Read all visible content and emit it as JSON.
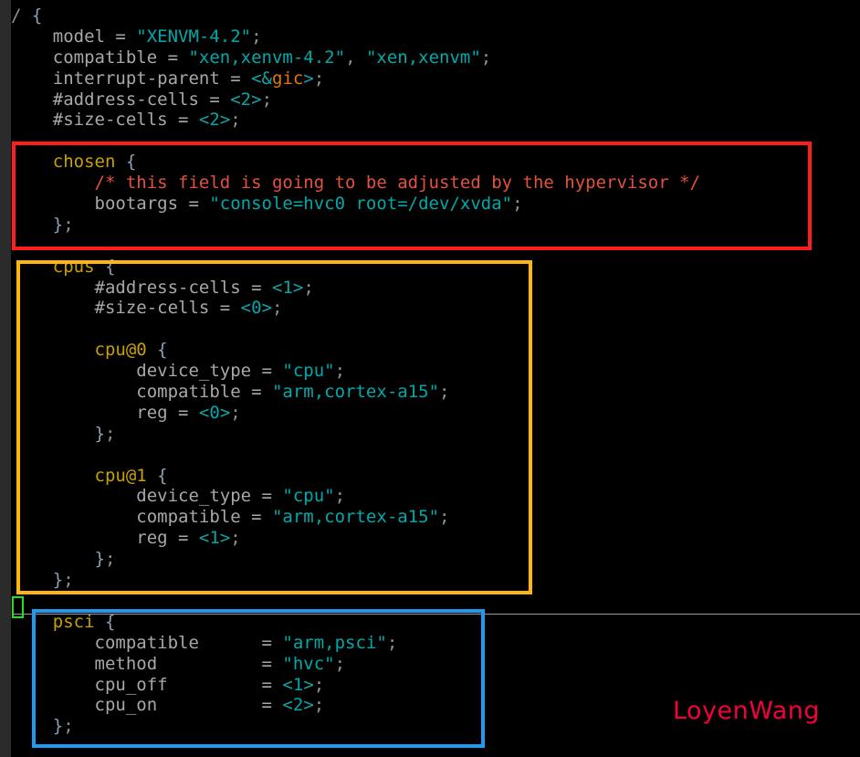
{
  "editor": {
    "language": "Device Tree Source",
    "background_color": "#000000",
    "gutter_color": "#2b2b2b",
    "default_text_color": "#b0b0b0"
  },
  "syntax_colors": {
    "node_name": "#c8a000",
    "property": "#a8a8a8",
    "string": "#00a9a9",
    "number": "#00a9a9",
    "angle_bracket": "#14a3a3",
    "phandle_reference": "#e07b00",
    "comment": "#e2523f",
    "brace": "#8aa0b4"
  },
  "code_lines": [
    {
      "id": "line-1",
      "indent": 0,
      "segments": [
        {
          "t": "punct",
          "v": "/ "
        },
        {
          "t": "brace",
          "v": "{"
        }
      ]
    },
    {
      "id": "line-2",
      "indent": 0,
      "segments": [
        {
          "t": "prop",
          "v": "    model = "
        },
        {
          "t": "str",
          "v": "\"XENVM-4.2\""
        },
        {
          "t": "punct",
          "v": ";"
        }
      ]
    },
    {
      "id": "line-3",
      "indent": 0,
      "segments": [
        {
          "t": "prop",
          "v": "    compatible = "
        },
        {
          "t": "str",
          "v": "\"xen,xenvm-4.2\""
        },
        {
          "t": "punct",
          "v": ", "
        },
        {
          "t": "str",
          "v": "\"xen,xenvm\""
        },
        {
          "t": "punct",
          "v": ";"
        }
      ]
    },
    {
      "id": "line-4",
      "indent": 0,
      "segments": [
        {
          "t": "prop",
          "v": "    interrupt-parent = "
        },
        {
          "t": "angle",
          "v": "<&"
        },
        {
          "t": "ref",
          "v": "gic"
        },
        {
          "t": "angle",
          "v": ">"
        },
        {
          "t": "punct",
          "v": ";"
        }
      ]
    },
    {
      "id": "line-5",
      "indent": 0,
      "segments": [
        {
          "t": "prop",
          "v": "    #address-cells = "
        },
        {
          "t": "angle",
          "v": "<"
        },
        {
          "t": "num",
          "v": "2"
        },
        {
          "t": "angle",
          "v": ">"
        },
        {
          "t": "punct",
          "v": ";"
        }
      ]
    },
    {
      "id": "line-6",
      "indent": 0,
      "segments": [
        {
          "t": "prop",
          "v": "    #size-cells = "
        },
        {
          "t": "angle",
          "v": "<"
        },
        {
          "t": "num",
          "v": "2"
        },
        {
          "t": "angle",
          "v": ">"
        },
        {
          "t": "punct",
          "v": ";"
        }
      ]
    },
    {
      "id": "line-7",
      "indent": 0,
      "segments": [
        {
          "t": "plain",
          "v": ""
        }
      ]
    },
    {
      "id": "line-8",
      "indent": 0,
      "segments": [
        {
          "t": "node",
          "v": "    chosen "
        },
        {
          "t": "brace",
          "v": "{"
        }
      ]
    },
    {
      "id": "line-9",
      "indent": 0,
      "segments": [
        {
          "t": "comment",
          "v": "        /* this field is going to be adjusted by the hypervisor */"
        }
      ]
    },
    {
      "id": "line-10",
      "indent": 0,
      "segments": [
        {
          "t": "prop",
          "v": "        bootargs = "
        },
        {
          "t": "str",
          "v": "\"console=hvc0 root=/dev/xvda\""
        },
        {
          "t": "punct",
          "v": ";"
        }
      ]
    },
    {
      "id": "line-11",
      "indent": 0,
      "segments": [
        {
          "t": "brace",
          "v": "    }"
        },
        {
          "t": "punct",
          "v": ";"
        }
      ]
    },
    {
      "id": "line-12",
      "indent": 0,
      "segments": [
        {
          "t": "plain",
          "v": ""
        }
      ]
    },
    {
      "id": "line-13",
      "indent": 0,
      "segments": [
        {
          "t": "node",
          "v": "    cpus "
        },
        {
          "t": "brace",
          "v": "{"
        }
      ]
    },
    {
      "id": "line-14",
      "indent": 0,
      "segments": [
        {
          "t": "prop",
          "v": "        #address-cells = "
        },
        {
          "t": "angle",
          "v": "<"
        },
        {
          "t": "num",
          "v": "1"
        },
        {
          "t": "angle",
          "v": ">"
        },
        {
          "t": "punct",
          "v": ";"
        }
      ]
    },
    {
      "id": "line-15",
      "indent": 0,
      "segments": [
        {
          "t": "prop",
          "v": "        #size-cells = "
        },
        {
          "t": "angle",
          "v": "<"
        },
        {
          "t": "num",
          "v": "0"
        },
        {
          "t": "angle",
          "v": ">"
        },
        {
          "t": "punct",
          "v": ";"
        }
      ]
    },
    {
      "id": "line-16",
      "indent": 0,
      "segments": [
        {
          "t": "plain",
          "v": ""
        }
      ]
    },
    {
      "id": "line-17",
      "indent": 0,
      "segments": [
        {
          "t": "node",
          "v": "        cpu@0 "
        },
        {
          "t": "brace",
          "v": "{"
        }
      ]
    },
    {
      "id": "line-18",
      "indent": 0,
      "segments": [
        {
          "t": "prop",
          "v": "            device_type = "
        },
        {
          "t": "str",
          "v": "\"cpu\""
        },
        {
          "t": "punct",
          "v": ";"
        }
      ]
    },
    {
      "id": "line-19",
      "indent": 0,
      "segments": [
        {
          "t": "prop",
          "v": "            compatible = "
        },
        {
          "t": "str",
          "v": "\"arm,cortex-a15\""
        },
        {
          "t": "punct",
          "v": ";"
        }
      ]
    },
    {
      "id": "line-20",
      "indent": 0,
      "segments": [
        {
          "t": "prop",
          "v": "            reg = "
        },
        {
          "t": "angle",
          "v": "<"
        },
        {
          "t": "num",
          "v": "0"
        },
        {
          "t": "angle",
          "v": ">"
        },
        {
          "t": "punct",
          "v": ";"
        }
      ]
    },
    {
      "id": "line-21",
      "indent": 0,
      "segments": [
        {
          "t": "brace",
          "v": "        }"
        },
        {
          "t": "punct",
          "v": ";"
        }
      ]
    },
    {
      "id": "line-22",
      "indent": 0,
      "segments": [
        {
          "t": "plain",
          "v": ""
        }
      ]
    },
    {
      "id": "line-23",
      "indent": 0,
      "segments": [
        {
          "t": "node",
          "v": "        cpu@1 "
        },
        {
          "t": "brace",
          "v": "{"
        }
      ]
    },
    {
      "id": "line-24",
      "indent": 0,
      "segments": [
        {
          "t": "prop",
          "v": "            device_type = "
        },
        {
          "t": "str",
          "v": "\"cpu\""
        },
        {
          "t": "punct",
          "v": ";"
        }
      ]
    },
    {
      "id": "line-25",
      "indent": 0,
      "segments": [
        {
          "t": "prop",
          "v": "            compatible = "
        },
        {
          "t": "str",
          "v": "\"arm,cortex-a15\""
        },
        {
          "t": "punct",
          "v": ";"
        }
      ]
    },
    {
      "id": "line-26",
      "indent": 0,
      "segments": [
        {
          "t": "prop",
          "v": "            reg = "
        },
        {
          "t": "angle",
          "v": "<"
        },
        {
          "t": "num",
          "v": "1"
        },
        {
          "t": "angle",
          "v": ">"
        },
        {
          "t": "punct",
          "v": ";"
        }
      ]
    },
    {
      "id": "line-27",
      "indent": 0,
      "segments": [
        {
          "t": "brace",
          "v": "        }"
        },
        {
          "t": "punct",
          "v": ";"
        }
      ]
    },
    {
      "id": "line-28",
      "indent": 0,
      "segments": [
        {
          "t": "brace",
          "v": "    }"
        },
        {
          "t": "punct",
          "v": ";"
        }
      ]
    },
    {
      "id": "line-29",
      "indent": 0,
      "segments": [
        {
          "t": "plain",
          "v": ""
        }
      ]
    },
    {
      "id": "line-30",
      "indent": 0,
      "segments": [
        {
          "t": "node",
          "v": "    psci "
        },
        {
          "t": "brace",
          "v": "{"
        }
      ]
    },
    {
      "id": "line-31",
      "indent": 0,
      "segments": [
        {
          "t": "prop",
          "v": "        compatible      = "
        },
        {
          "t": "str",
          "v": "\"arm,psci\""
        },
        {
          "t": "punct",
          "v": ";"
        }
      ]
    },
    {
      "id": "line-32",
      "indent": 0,
      "segments": [
        {
          "t": "prop",
          "v": "        method          = "
        },
        {
          "t": "str",
          "v": "\"hvc\""
        },
        {
          "t": "punct",
          "v": ";"
        }
      ]
    },
    {
      "id": "line-33",
      "indent": 0,
      "segments": [
        {
          "t": "prop",
          "v": "        cpu_off         = "
        },
        {
          "t": "angle",
          "v": "<"
        },
        {
          "t": "num",
          "v": "1"
        },
        {
          "t": "angle",
          "v": ">"
        },
        {
          "t": "punct",
          "v": ";"
        }
      ]
    },
    {
      "id": "line-34",
      "indent": 0,
      "segments": [
        {
          "t": "prop",
          "v": "        cpu_on          = "
        },
        {
          "t": "angle",
          "v": "<"
        },
        {
          "t": "num",
          "v": "2"
        },
        {
          "t": "angle",
          "v": ">"
        },
        {
          "t": "punct",
          "v": ";"
        }
      ]
    },
    {
      "id": "line-35",
      "indent": 0,
      "segments": [
        {
          "t": "brace",
          "v": "    }"
        },
        {
          "t": "punct",
          "v": ";"
        }
      ]
    }
  ],
  "annotations": [
    {
      "id": "chosen-highlight",
      "label": "chosen-node-highlight",
      "color": "#ff1d1d"
    },
    {
      "id": "cpus-highlight",
      "label": "cpus-node-highlight",
      "color": "#ffb511"
    },
    {
      "id": "psci-highlight",
      "label": "psci-node-highlight",
      "color": "#1e9bf0"
    },
    {
      "id": "cursor-marker",
      "label": "cursor-fold-marker",
      "color": "#19e619"
    }
  ],
  "watermark": {
    "text": "LoyenWang",
    "color": "#f5003c"
  }
}
